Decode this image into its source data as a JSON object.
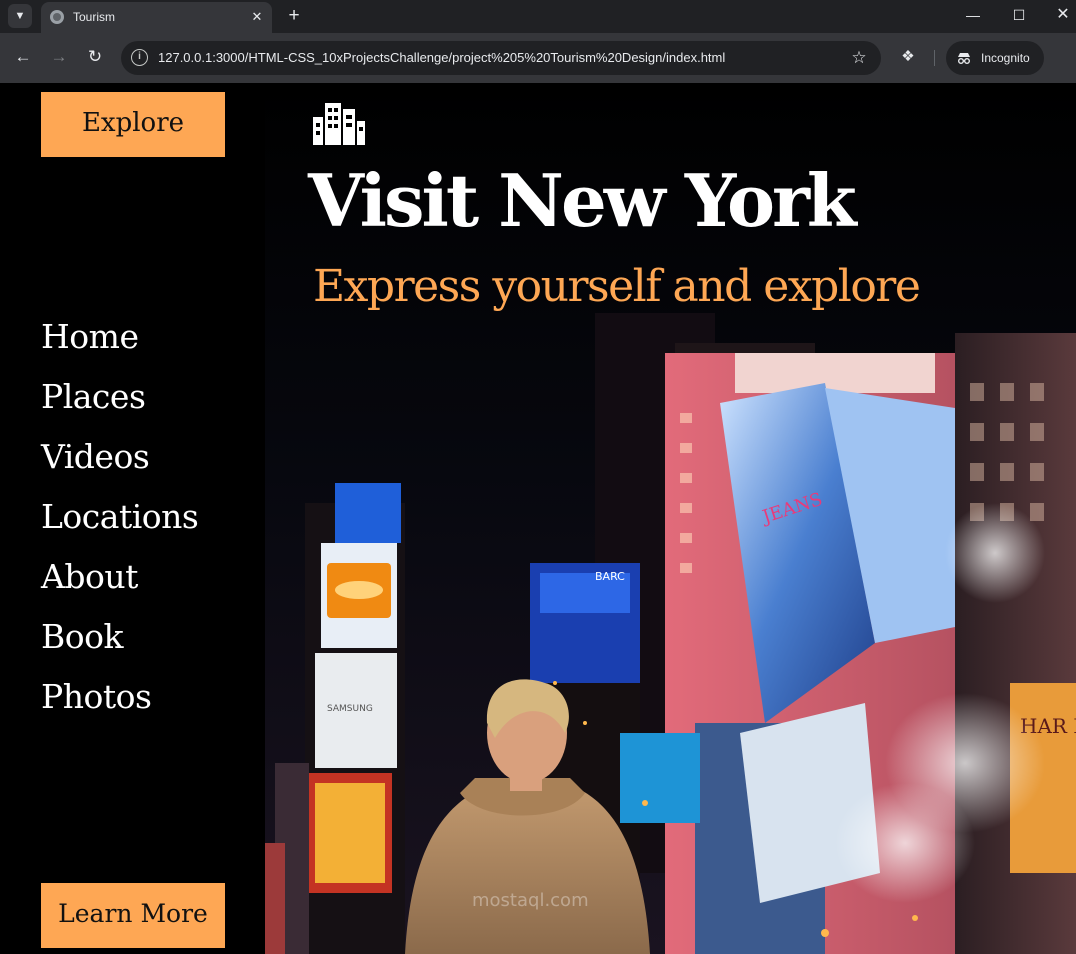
{
  "browser": {
    "tab_title": "Tourism",
    "url": "127.0.0.1:3000/HTML-CSS_10xProjectsChallenge/project%205%20Tourism%20Design/index.html",
    "profile_label": "Incognito"
  },
  "page": {
    "explore_label": "Explore",
    "learn_more_label": "Learn More",
    "nav": [
      "Home",
      "Places",
      "Videos",
      "Locations",
      "About",
      "Book",
      "Photos"
    ],
    "hero": {
      "title": "Visit New York",
      "subtitle": "Express yourself and explore",
      "icon": "city-icon",
      "sign_samsung": "SAMSUNG",
      "sign_jeans": "JEANS",
      "sign_barc": "BARC",
      "sign_harry_potter": "HAR POT",
      "watermark": "mostaql.com"
    }
  },
  "colors": {
    "accent": "#fea754",
    "background": "#000000",
    "text": "#ffffff"
  }
}
